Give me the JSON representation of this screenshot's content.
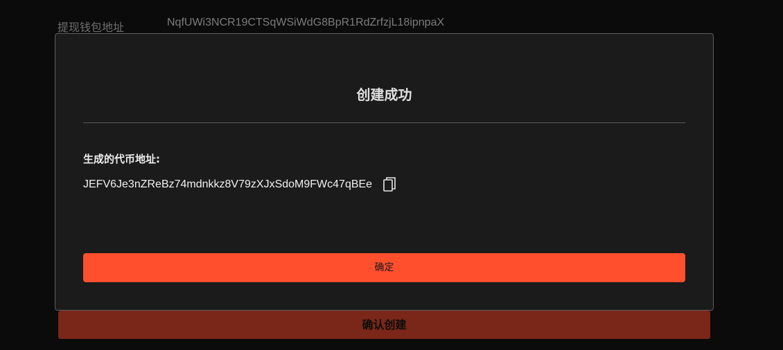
{
  "background_form": {
    "wallet_label": "提现钱包地址",
    "wallet_value": "NqfUWi3NCR19CTSqWSiWdG8BpR1RdZrfzjL18ipnpaX",
    "submit_label": "确认创建"
  },
  "modal": {
    "title": "创建成功",
    "address_label": "生成的代币地址:",
    "address_value": "JEFV6Je3nZReBz74mdnkkz8V79zXJxSdoM9FWc47qBEe",
    "copy_icon": "copy-icon",
    "confirm_label": "确定"
  },
  "colors": {
    "accent": "#ff4f2d",
    "accent_dimmed": "#7a2619",
    "modal_bg": "#1b1b1b",
    "page_bg": "#0b0b0b"
  }
}
